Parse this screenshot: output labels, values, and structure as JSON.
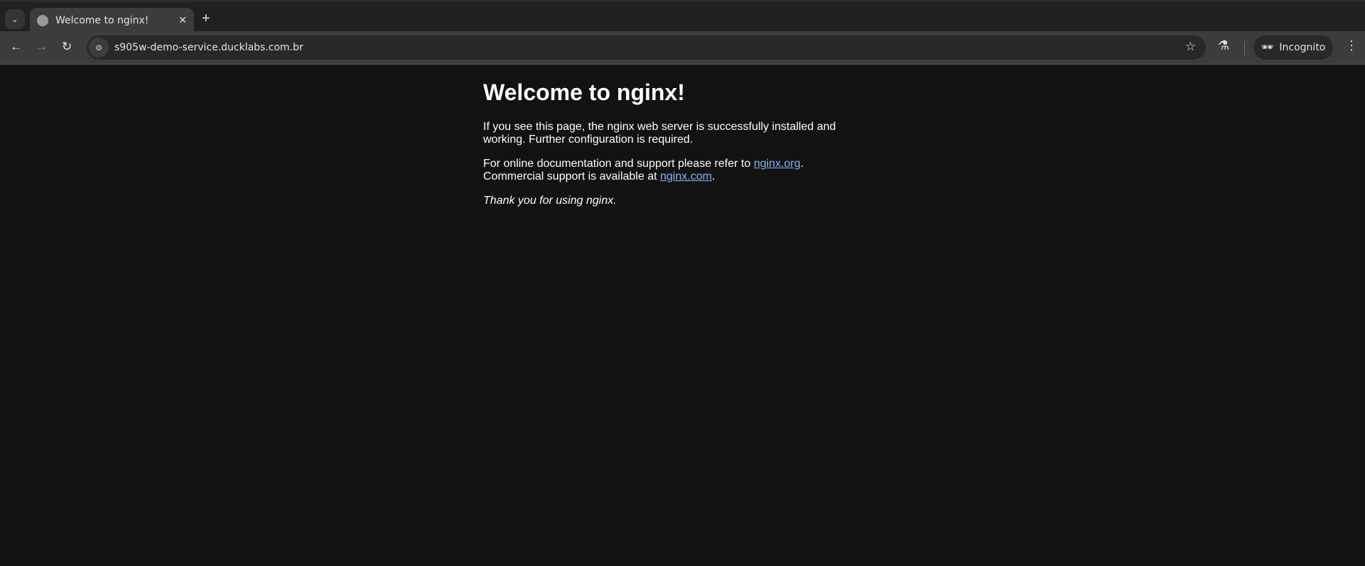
{
  "browser": {
    "tab_title": "Welcome to nginx!",
    "url": "s905w-demo-service.ducklabs.com.br",
    "profile_label": "Incognito"
  },
  "page": {
    "heading": "Welcome to nginx!",
    "p1": "If you see this page, the nginx web server is successfully installed and working. Further configuration is required.",
    "p2_prefix": "For online documentation and support please refer to ",
    "link_org": "nginx.org",
    "p2_mid": ".",
    "p2_line2": "Commercial support is available at ",
    "link_com": "nginx.com",
    "p2_end": ".",
    "thanks": "Thank you for using nginx."
  }
}
